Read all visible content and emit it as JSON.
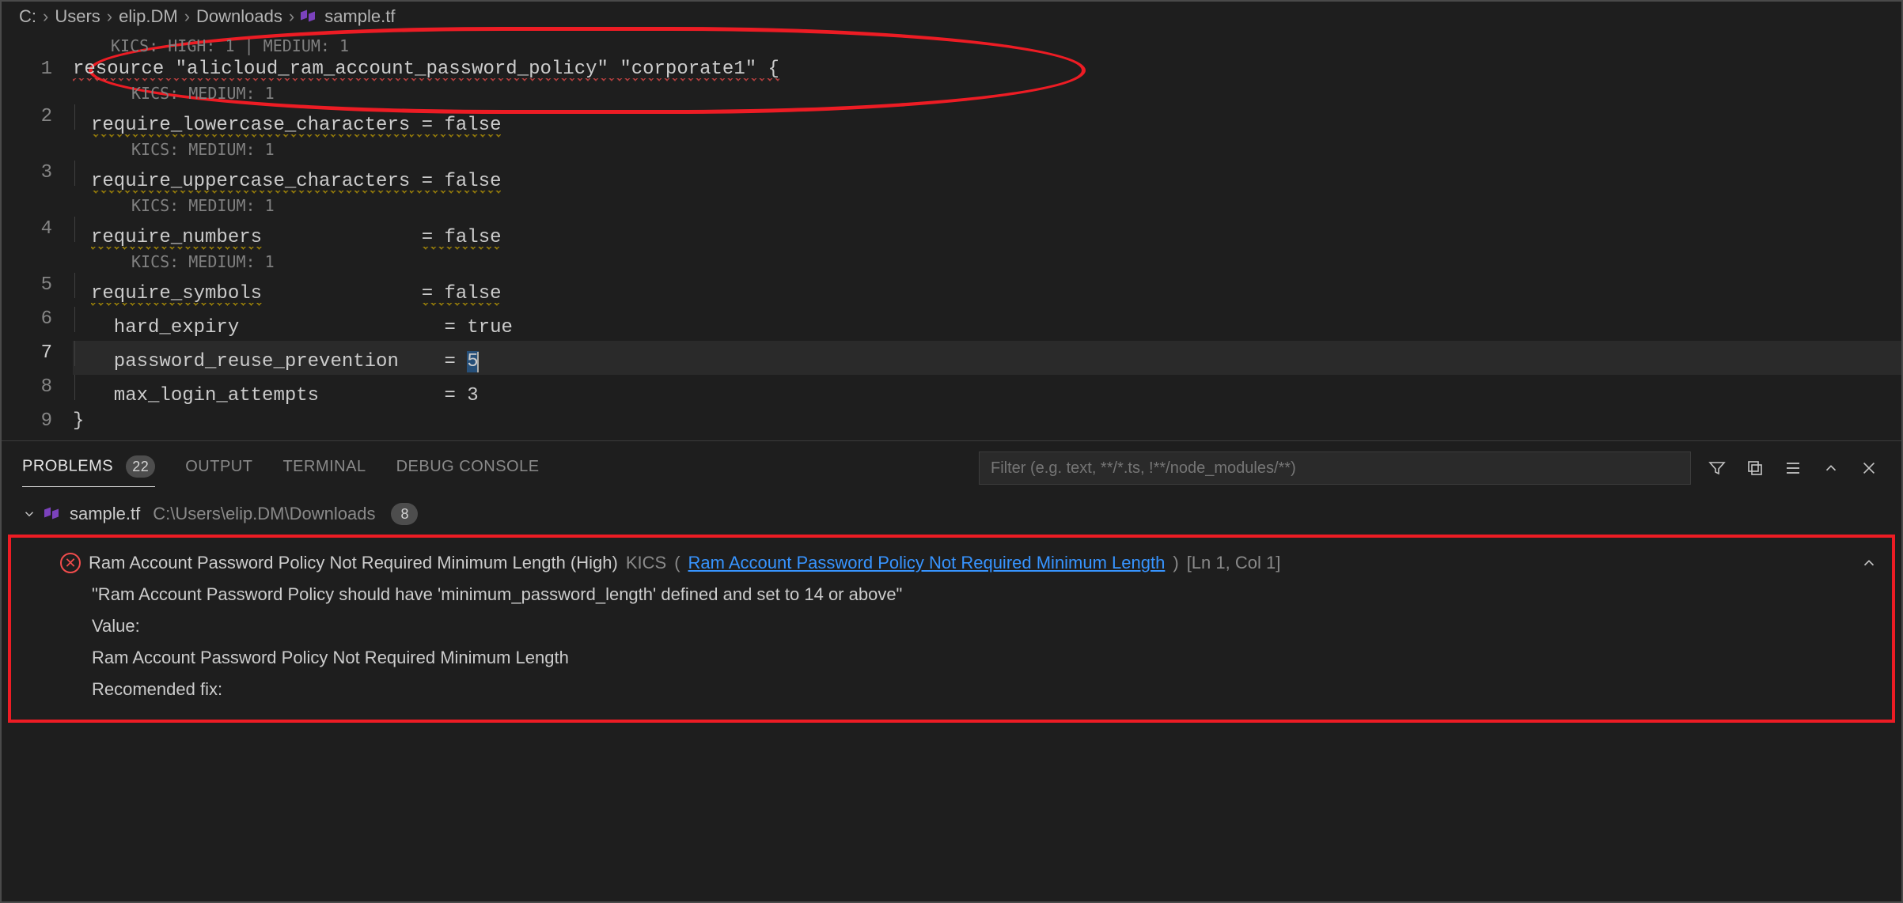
{
  "breadcrumb": {
    "segments": [
      "C:",
      "Users",
      "elip.DM",
      "Downloads",
      "sample.tf"
    ]
  },
  "editor": {
    "codelens_top": "KICS: HIGH: 1 | MEDIUM: 1",
    "codelens_med": "KICS: MEDIUM: 1",
    "lines": {
      "l1": "resource \"alicloud_ram_account_password_policy\" \"corporate1\" {",
      "l2_key": "require_lowercase_characters",
      "l2_val": " = false",
      "l3_key": "require_uppercase_characters",
      "l3_val": " = false",
      "l4_key": "require_numbers",
      "l4_pad": "              ",
      "l4_val": "= false",
      "l5_key": "require_symbols",
      "l5_pad": "              ",
      "l5_val": "= false",
      "l6": "  hard_expiry                  = true",
      "l7a": "  password_reuse_prevention    = ",
      "l7b": "5",
      "l8": "  max_login_attempts           = 3",
      "l9": "}"
    },
    "line_numbers": [
      "1",
      "2",
      "3",
      "4",
      "5",
      "6",
      "7",
      "8",
      "9"
    ],
    "current_line_index": 6
  },
  "panel": {
    "tabs": {
      "problems": "PROBLEMS",
      "problems_count": "22",
      "output": "OUTPUT",
      "terminal": "TERMINAL",
      "debug": "DEBUG CONSOLE"
    },
    "filter_placeholder": "Filter (e.g. text, **/*.ts, !**/node_modules/**)"
  },
  "problems": {
    "file_name": "sample.tf",
    "file_path": "C:\\Users\\elip.DM\\Downloads",
    "file_badge": "8",
    "item": {
      "title": "Ram Account Password Policy Not Required Minimum Length (High)",
      "source": "KICS",
      "link_text": "Ram Account Password Policy Not Required Minimum Length",
      "location": "[Ln 1, Col 1]",
      "msg": "\"Ram Account Password Policy should have 'minimum_password_length' defined and set to 14 or above\"",
      "value_label": "Value:",
      "value_body": "Ram Account Password Policy Not Required Minimum Length",
      "fix_label": "Recomended fix:"
    }
  }
}
